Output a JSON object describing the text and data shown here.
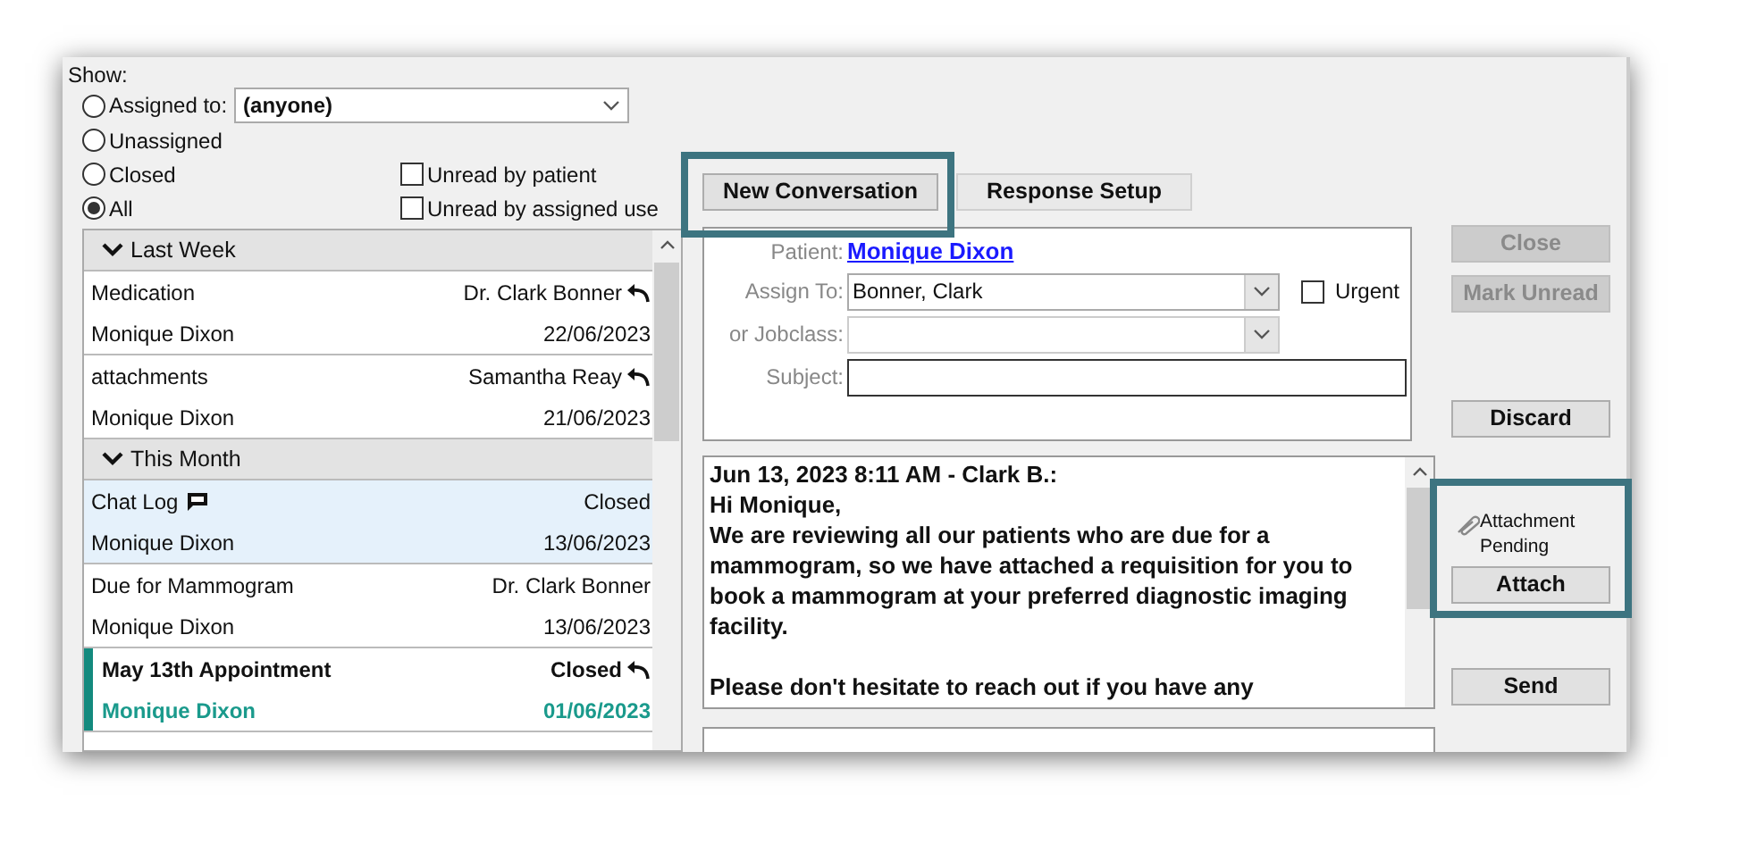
{
  "show": {
    "label": "Show:",
    "assigned_dropdown": {
      "value": "(anyone)"
    },
    "radios": [
      {
        "label": "Assigned to:",
        "selected": false
      },
      {
        "label": "Unassigned",
        "selected": false
      },
      {
        "label": "Closed",
        "selected": false
      },
      {
        "label": "All",
        "selected": true
      }
    ],
    "checkboxes": [
      {
        "label": "Unread by patient",
        "checked": false
      },
      {
        "label": "Unread by assigned use",
        "checked": false
      }
    ]
  },
  "conversation_list": {
    "groups": [
      {
        "label": "Last Week",
        "expanded": true,
        "items": [
          {
            "subject": "Medication",
            "status": "Dr. Clark Bonner",
            "patient": "Monique Dixon",
            "date": "22/06/2023",
            "replied": true,
            "chat": false,
            "selected": false,
            "unread": false
          },
          {
            "subject": "attachments",
            "status": "Samantha Reay",
            "patient": "Monique Dixon",
            "date": "21/06/2023",
            "replied": true,
            "chat": false,
            "selected": false,
            "unread": false
          }
        ]
      },
      {
        "label": "This Month",
        "expanded": true,
        "items": [
          {
            "subject": "Chat Log",
            "status": "Closed",
            "patient": "Monique Dixon",
            "date": "13/06/2023",
            "replied": false,
            "chat": true,
            "selected": true,
            "unread": false
          },
          {
            "subject": "Due for Mammogram",
            "status": "Dr. Clark Bonner",
            "patient": "Monique Dixon",
            "date": "13/06/2023",
            "replied": false,
            "chat": false,
            "selected": false,
            "unread": false
          },
          {
            "subject": "May 13th Appointment",
            "status": "Closed",
            "patient": "Monique Dixon",
            "date": "01/06/2023",
            "replied": true,
            "chat": false,
            "selected": false,
            "unread": true
          }
        ]
      }
    ]
  },
  "tabs": [
    {
      "label": "New Conversation",
      "selected": true
    },
    {
      "label": "Response Setup",
      "selected": false
    }
  ],
  "form": {
    "patient_label": "Patient:",
    "patient": "Monique Dixon",
    "assign_label": "Assign To:",
    "assign_value": "Bonner, Clark",
    "urgent": {
      "label": "Urgent",
      "checked": false
    },
    "jobclass_label": "or Jobclass:",
    "subject_label": "Subject:"
  },
  "side_buttons": [
    {
      "label": "Close",
      "disabled": true
    },
    {
      "label": "Mark Unread",
      "disabled": true
    },
    {
      "label": "Discard",
      "disabled": false
    }
  ],
  "message": {
    "blocks": [
      [
        "Jun 13, 2023 8:11 AM - Clark B.:",
        "Hi Monique,",
        "We are reviewing all our patients who are due for a mammogram, so we have attached a requisition for you to book a mammogram at your preferred diagnostic imaging facility."
      ],
      [
        "Please don't hesitate to reach out if you have any"
      ]
    ]
  },
  "attachment": {
    "status": "Attachment Pending",
    "button": "Attach"
  },
  "send_button": "Send"
}
